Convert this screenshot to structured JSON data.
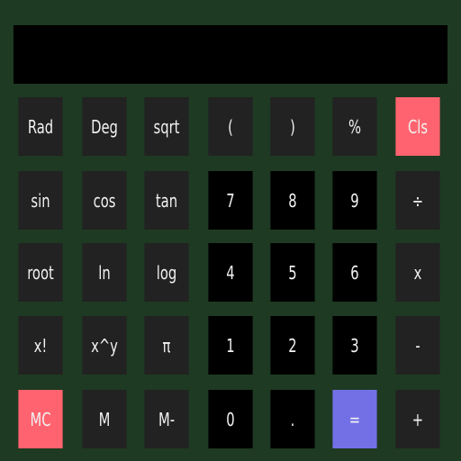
{
  "display": {
    "value": ""
  },
  "colors": {
    "background": "#1e3a22",
    "button": "#222222",
    "digit": "#000000",
    "clear": "#fe636f",
    "equals": "#7370e6"
  },
  "rows": [
    [
      {
        "label": "Rad",
        "name": "rad-button",
        "type": "fn"
      },
      {
        "label": "Deg",
        "name": "deg-button",
        "type": "fn"
      },
      {
        "label": "sqrt",
        "name": "sqrt-button",
        "type": "fn"
      },
      {
        "label": "(",
        "name": "open-paren-button",
        "type": "fn"
      },
      {
        "label": ")",
        "name": "close-paren-button",
        "type": "fn"
      },
      {
        "label": "%",
        "name": "percent-button",
        "type": "fn"
      },
      {
        "label": "Cls",
        "name": "clear-button",
        "type": "danger"
      }
    ],
    [
      {
        "label": "sin",
        "name": "sin-button",
        "type": "fn"
      },
      {
        "label": "cos",
        "name": "cos-button",
        "type": "fn"
      },
      {
        "label": "tan",
        "name": "tan-button",
        "type": "fn"
      },
      {
        "label": "7",
        "name": "digit-7-button",
        "type": "num"
      },
      {
        "label": "8",
        "name": "digit-8-button",
        "type": "num"
      },
      {
        "label": "9",
        "name": "digit-9-button",
        "type": "num"
      },
      {
        "label": "÷",
        "name": "divide-button",
        "type": "fn"
      }
    ],
    [
      {
        "label": "root",
        "name": "root-button",
        "type": "fn"
      },
      {
        "label": "ln",
        "name": "ln-button",
        "type": "fn"
      },
      {
        "label": "log",
        "name": "log-button",
        "type": "fn"
      },
      {
        "label": "4",
        "name": "digit-4-button",
        "type": "num"
      },
      {
        "label": "5",
        "name": "digit-5-button",
        "type": "num"
      },
      {
        "label": "6",
        "name": "digit-6-button",
        "type": "num"
      },
      {
        "label": "x",
        "name": "multiply-button",
        "type": "fn"
      }
    ],
    [
      {
        "label": "x!",
        "name": "factorial-button",
        "type": "fn"
      },
      {
        "label": "x^y",
        "name": "power-button",
        "type": "fn"
      },
      {
        "label": "π",
        "name": "pi-button",
        "type": "fn"
      },
      {
        "label": "1",
        "name": "digit-1-button",
        "type": "num"
      },
      {
        "label": "2",
        "name": "digit-2-button",
        "type": "num"
      },
      {
        "label": "3",
        "name": "digit-3-button",
        "type": "num"
      },
      {
        "label": "-",
        "name": "subtract-button",
        "type": "fn"
      }
    ],
    [
      {
        "label": "MC",
        "name": "memory-clear-button",
        "type": "danger"
      },
      {
        "label": "M",
        "name": "memory-button",
        "type": "fn"
      },
      {
        "label": "M-",
        "name": "memory-minus-button",
        "type": "fn"
      },
      {
        "label": "0",
        "name": "digit-0-button",
        "type": "num"
      },
      {
        "label": ".",
        "name": "decimal-button",
        "type": "num"
      },
      {
        "label": "=",
        "name": "equals-button",
        "type": "eq"
      },
      {
        "label": "+",
        "name": "add-button",
        "type": "fn"
      }
    ]
  ]
}
